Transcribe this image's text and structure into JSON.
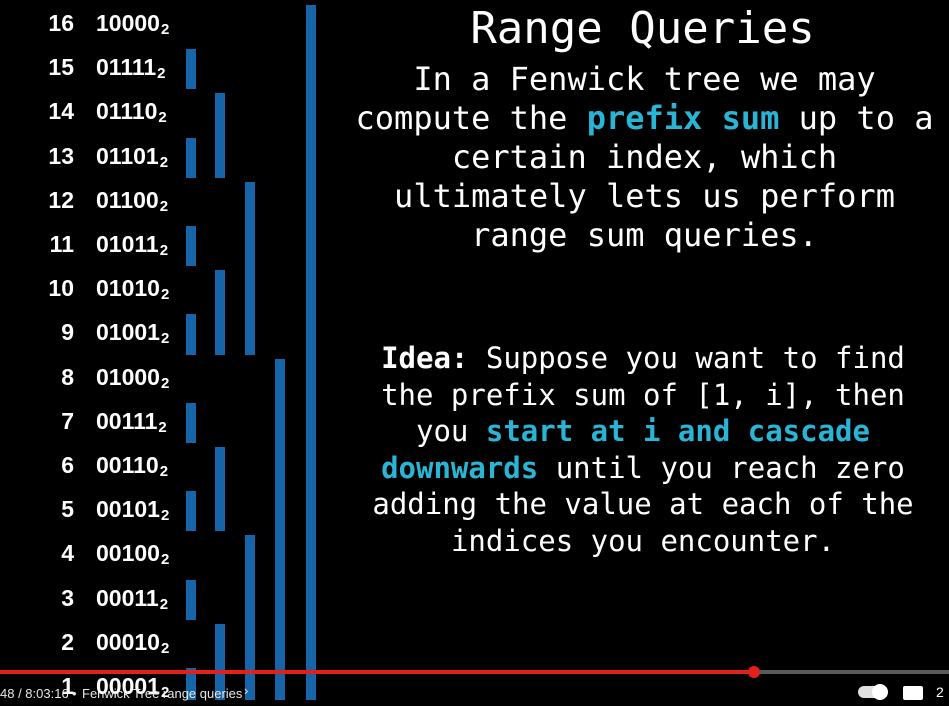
{
  "slide": {
    "title": "Range Queries",
    "para1": {
      "before": "In a Fenwick tree we may compute the ",
      "highlight": "prefix sum",
      "after": " up to a certain index, which ultimately lets us perform range sum queries."
    },
    "para2": {
      "label": "Idea:",
      "before": " Suppose you want to find the prefix sum of [1, i], then you ",
      "highlight1": "start at i and cascade downwards",
      "after": " until you reach zero adding the value at each of the indices you encounter."
    },
    "rows": [
      {
        "index": "16",
        "binary": "10000",
        "base": "2"
      },
      {
        "index": "15",
        "binary": "01111",
        "base": "2"
      },
      {
        "index": "14",
        "binary": "01110",
        "base": "2"
      },
      {
        "index": "13",
        "binary": "01101",
        "base": "2"
      },
      {
        "index": "12",
        "binary": "01100",
        "base": "2"
      },
      {
        "index": "11",
        "binary": "01011",
        "base": "2"
      },
      {
        "index": "10",
        "binary": "01010",
        "base": "2"
      },
      {
        "index": "9",
        "binary": "01001",
        "base": "2"
      },
      {
        "index": "8",
        "binary": "01000",
        "base": "2"
      },
      {
        "index": "7",
        "binary": "00111",
        "base": "2"
      },
      {
        "index": "6",
        "binary": "00110",
        "base": "2"
      },
      {
        "index": "5",
        "binary": "00101",
        "base": "2"
      },
      {
        "index": "4",
        "binary": "00100",
        "base": "2"
      },
      {
        "index": "3",
        "binary": "00011",
        "base": "2"
      },
      {
        "index": "2",
        "binary": "00010",
        "base": "2"
      },
      {
        "index": "1",
        "binary": "00001",
        "base": "2"
      }
    ],
    "bar_color": "#1565a8",
    "highlight_color": "#29b6d6"
  },
  "player": {
    "time": "48 / 8:03:16",
    "separator": "•",
    "chapter": "Fenwick Tree range queries",
    "chevron_icon": "chevron-right-icon",
    "progress_fraction": 0.795,
    "progress_color": "#e3201c",
    "settings_glyph": "2"
  }
}
